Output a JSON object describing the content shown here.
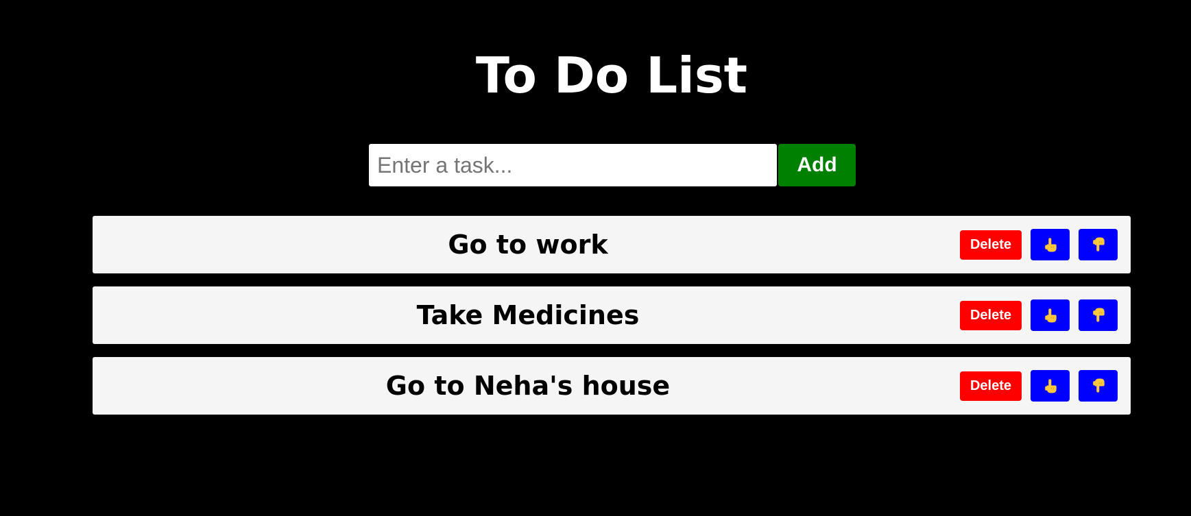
{
  "header": {
    "title": "To Do List"
  },
  "add_form": {
    "placeholder": "Enter a task...",
    "value": "",
    "add_label": "Add"
  },
  "tasks": [
    {
      "text": "Go to work",
      "delete_label": "Delete"
    },
    {
      "text": "Take Medicines",
      "delete_label": "Delete"
    },
    {
      "text": "Go to Neha's house",
      "delete_label": "Delete"
    }
  ],
  "icons": {
    "move_up": "pointing-up-hand-icon",
    "move_down": "pointing-down-hand-icon"
  },
  "colors": {
    "background": "#000000",
    "add_button": "#008000",
    "delete_button": "#ff0000",
    "move_button": "#0000ff",
    "hand_icon": "#ffc83d",
    "task_row": "#f5f5f5"
  }
}
